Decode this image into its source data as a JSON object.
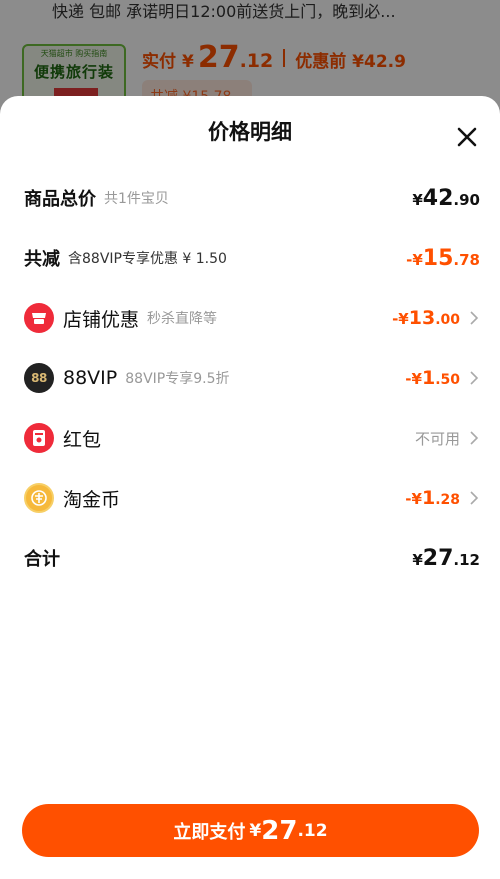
{
  "background": {
    "shipping_text": "快递 包邮 承诺明日12:00前送货上门，晚到必...",
    "product_badge": "天猫超市 购买指南",
    "product_name": "便携旅行装",
    "pay_label": "实付",
    "currency": "¥",
    "pay_int": "27",
    "pay_dec": ".12",
    "pre_discount": "优惠前 ¥42.9",
    "discount_pill": "共减 ¥15.78 >"
  },
  "sheet": {
    "title": "价格明细",
    "total": {
      "label": "商品总价",
      "sub": "共1件宝贝",
      "yen": "¥",
      "int": "42",
      "dec": ".90"
    },
    "reduction": {
      "label": "共减",
      "sub": "含88VIP专享优惠 ¥ 1.50",
      "yen": "-¥",
      "int": "15",
      "dec": ".78"
    },
    "items": [
      {
        "label": "店铺优惠",
        "sub": "秒杀直降等",
        "yen": "-¥",
        "int": "13",
        "dec": ".00",
        "icon": "store-icon"
      },
      {
        "label": "88VIP",
        "sub": "88VIP专享9.5折",
        "yen": "-¥",
        "int": "1",
        "dec": ".50",
        "icon": "88vip-icon",
        "icon_text": "88"
      },
      {
        "label": "红包",
        "sub": "",
        "status": "不可用",
        "icon": "red-packet-icon"
      },
      {
        "label": "淘金币",
        "sub": "",
        "yen": "-¥",
        "int": "1",
        "dec": ".28",
        "icon": "coin-icon"
      }
    ],
    "sum": {
      "label": "合计",
      "yen": "¥",
      "int": "27",
      "dec": ".12"
    },
    "pay_button": {
      "label": "立即支付",
      "yen": "¥",
      "int": "27",
      "dec": ".12"
    }
  },
  "colors": {
    "accent": "#ff5000",
    "muted": "#999999"
  }
}
